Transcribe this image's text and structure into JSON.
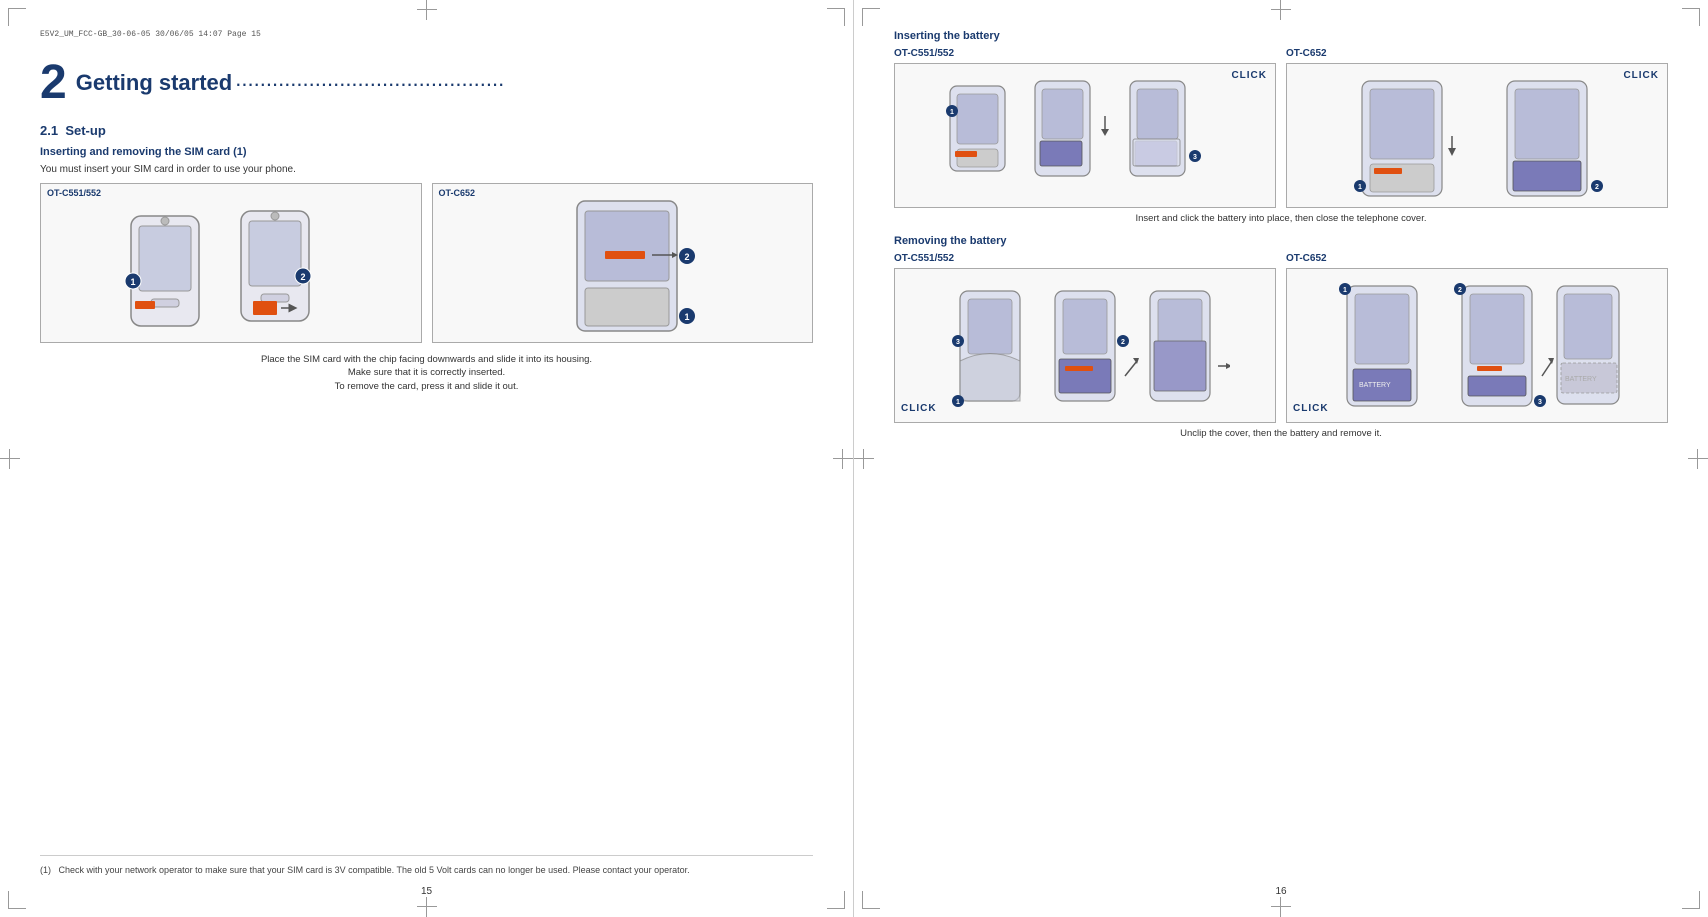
{
  "left_page": {
    "header": "E5V2_UM_FCC-GB_30-06-05   30/06/05   14:07   Page 15",
    "chapter_num": "2",
    "chapter_title": "Getting started",
    "chapter_dots": "............................................",
    "section_num": "2.1",
    "section_title": "Set-up",
    "subsection_title": "Inserting and removing the SIM card (1)",
    "body_text": "You must insert your SIM card in order to use your phone.",
    "model_left": "OT-C551/552",
    "model_right": "OT-C652",
    "caption": "Place the SIM card with the chip facing downwards and slide it into its housing.\nMake sure that it is correctly inserted.\nTo remove the card, press it and slide it out.",
    "footnote_num": "(1)",
    "footnote_text": "Check with your network operator to make sure that your SIM card is 3V compatible. The old 5 Volt cards can no longer be used. Please contact your operator.",
    "page_number": "15"
  },
  "right_page": {
    "inserting_title": "Inserting the battery",
    "model_left_ins": "OT-C551/552",
    "model_right_ins": "OT-C652",
    "click_label_ins_left": "CLICK",
    "click_label_ins_right": "CLICK",
    "insert_caption": "Insert and click the battery into place, then close the telephone cover.",
    "removing_title": "Removing the battery",
    "model_left_rem": "OT-C551/552",
    "model_right_rem": "OT-C652",
    "click_label_rem_left": "CLICK",
    "click_label_rem_right": "CLICK",
    "remove_caption": "Unclip the cover, then the battery and remove it.",
    "page_number": "16"
  }
}
